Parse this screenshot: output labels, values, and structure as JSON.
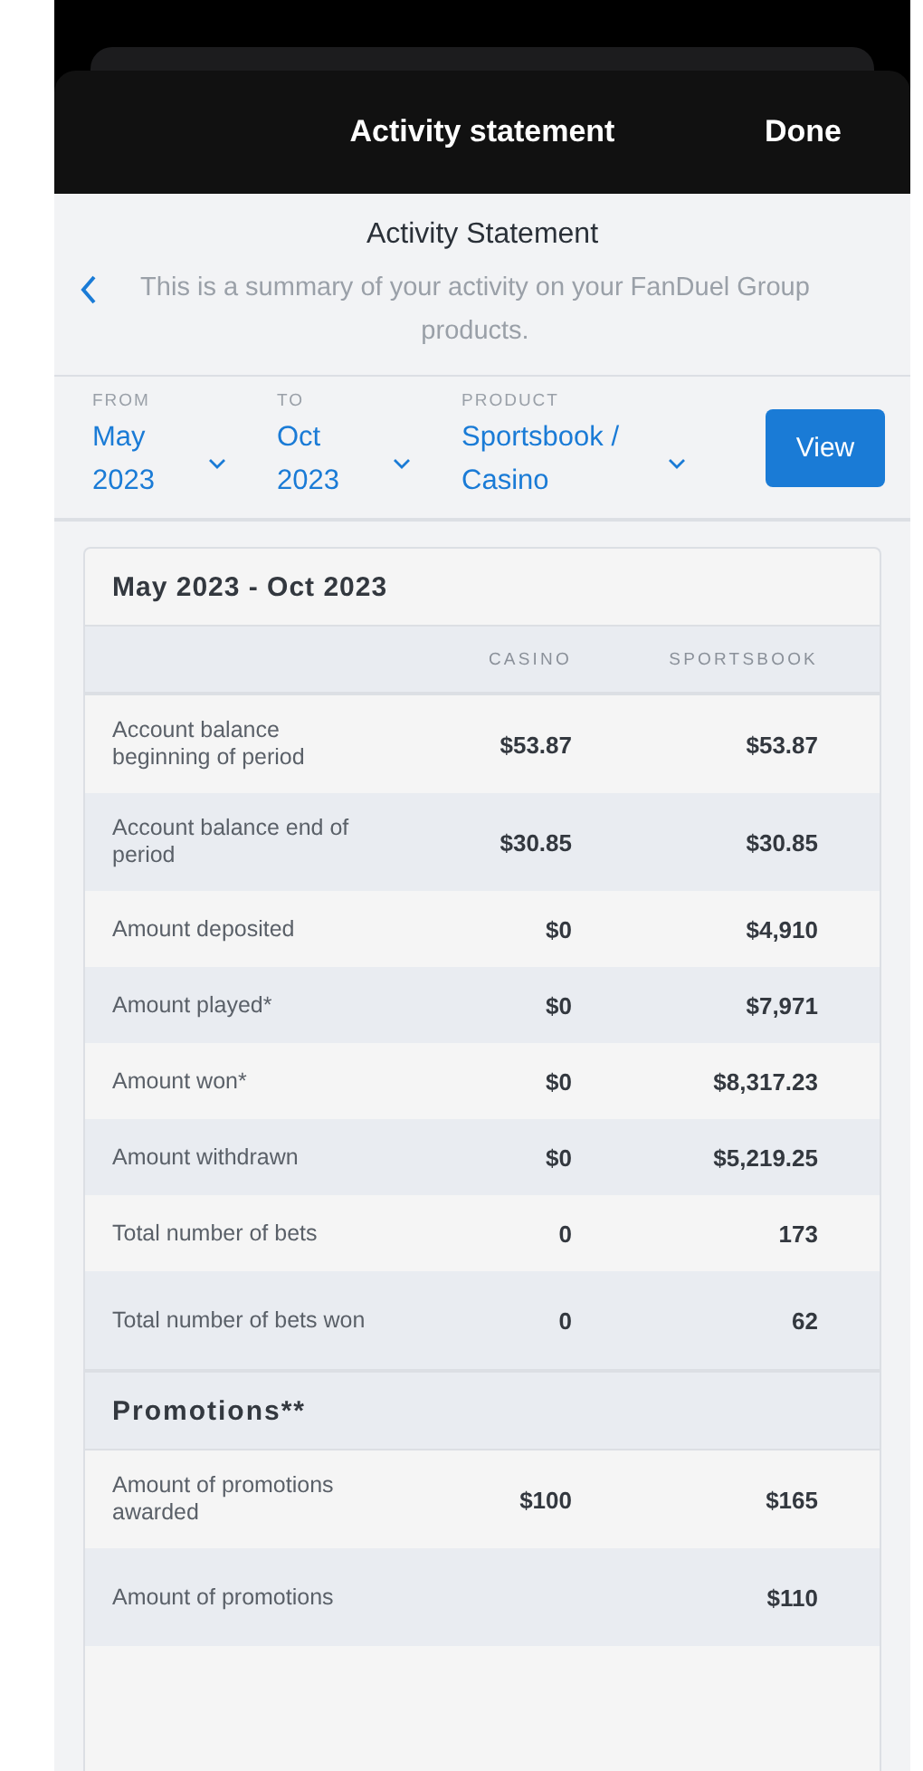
{
  "header": {
    "title": "Activity statement",
    "done": "Done"
  },
  "intro": {
    "title": "Activity Statement",
    "text": "This is a summary of your activity on your FanDuel Group products."
  },
  "filters": [
    {
      "label": "FROM",
      "value": "May 2023"
    },
    {
      "label": "TO",
      "value": "Oct 2023"
    },
    {
      "label": "PRODUCT",
      "value": "Sportsbook / Casino"
    }
  ],
  "view_button": "View",
  "statement": {
    "period": "May 2023 - Oct 2023",
    "columns": [
      "CASINO",
      "SPORTSBOOK"
    ],
    "rows": [
      {
        "label": "Account balance beginning of period",
        "casino": "$53.87",
        "sportsbook": "$53.87"
      },
      {
        "label": "Account balance end of period",
        "casino": "$30.85",
        "sportsbook": "$30.85"
      },
      {
        "label": "Amount deposited",
        "casino": "$0",
        "sportsbook": "$4,910"
      },
      {
        "label": "Amount played*",
        "casino": "$0",
        "sportsbook": "$7,971"
      },
      {
        "label": "Amount won*",
        "casino": "$0",
        "sportsbook": "$8,317.23"
      },
      {
        "label": "Amount withdrawn",
        "casino": "$0",
        "sportsbook": "$5,219.25"
      },
      {
        "label": "Total number of bets",
        "casino": "0",
        "sportsbook": "173"
      },
      {
        "label": "Total number of bets won",
        "casino": "0",
        "sportsbook": "62"
      }
    ],
    "promotions": {
      "title": "Promotions**",
      "rows": [
        {
          "label": "Amount of promotions awarded",
          "casino": "$100",
          "sportsbook": "$165"
        },
        {
          "label": "Amount of promotions",
          "casino": "",
          "sportsbook": "$110"
        }
      ]
    }
  }
}
